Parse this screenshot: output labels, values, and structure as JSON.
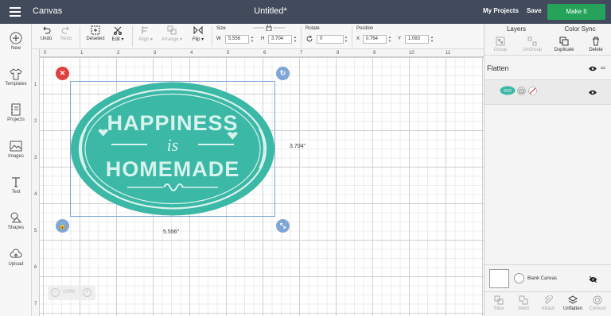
{
  "topbar": {
    "app_title": "Canvas",
    "doc_title": "Untitled*",
    "my_projects": "My Projects",
    "save": "Save",
    "make_it": "Make It",
    "make_it_color": "#25a35a"
  },
  "sidebar": {
    "items": [
      {
        "label": "New",
        "icon": "plus-icon"
      },
      {
        "label": "Templates",
        "icon": "shirt-icon"
      },
      {
        "label": "Projects",
        "icon": "notebook-icon"
      },
      {
        "label": "Images",
        "icon": "image-icon"
      },
      {
        "label": "Text",
        "icon": "text-icon"
      },
      {
        "label": "Shapes",
        "icon": "shapes-icon"
      },
      {
        "label": "Upload",
        "icon": "upload-icon"
      }
    ]
  },
  "toolbar": {
    "undo": "Undo",
    "redo": "Redo",
    "deselect": "Deselect",
    "edit": "Edit",
    "align": "Align",
    "arrange": "Arrange",
    "flip": "Flip",
    "size_label": "Size",
    "w_label": "W",
    "w_value": "5.556",
    "h_label": "H",
    "h_value": "3.704",
    "rotate_label": "Rotate",
    "rotate_value": "0",
    "position_label": "Position",
    "x_label": "X",
    "x_value": "0.764",
    "y_label": "Y",
    "y_value": "1.083"
  },
  "ruler": {
    "top": [
      "0",
      "1",
      "2",
      "3",
      "4",
      "5",
      "6",
      "7",
      "8",
      "9",
      "10",
      "11"
    ],
    "left": [
      "1",
      "2",
      "3",
      "4",
      "5",
      "6",
      "7"
    ]
  },
  "canvas": {
    "design_line1": "HAPPINESS",
    "design_line2": "is",
    "design_line3": "HOMEMADE",
    "design_color": "#3bb8a6",
    "design_light": "#d8f3ee",
    "width_dim": "5.556\"",
    "height_dim": "3.704\"",
    "zoom": "100%"
  },
  "panel": {
    "tab_layers": "Layers",
    "tab_color_sync": "Color Sync",
    "group": "Group",
    "ungroup": "UnGroup",
    "duplicate": "Duplicate",
    "delete": "Delete",
    "flatten": "Flatten",
    "blank_canvas": "Blank Canvas",
    "slice": "Slice",
    "weld": "Weld",
    "attach": "Attach",
    "unflatten": "Unflatten",
    "contour": "Contour"
  }
}
